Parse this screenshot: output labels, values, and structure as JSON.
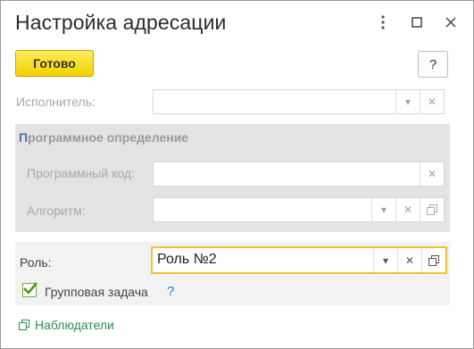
{
  "window": {
    "title": "Настройка адресации"
  },
  "toolbar": {
    "ready_label": "Готово",
    "help_label": "?"
  },
  "executor": {
    "label": "Исполнитель:",
    "value": ""
  },
  "program_definition": {
    "title_first": "П",
    "title_rest": "рограммное определение",
    "code_label": "Программный код:",
    "code_value": "",
    "algorithm_label": "Алгоритм:",
    "algorithm_value": ""
  },
  "role": {
    "label": "Роль:",
    "value": "Роль №2"
  },
  "group_task": {
    "label": "Групповая задача",
    "checked": true,
    "help": "?"
  },
  "observers": {
    "label": "Наблюдатели"
  },
  "colors": {
    "accent_yellow": "#f2d100",
    "focus_border": "#f1c232",
    "link_green": "#2e8b57"
  }
}
